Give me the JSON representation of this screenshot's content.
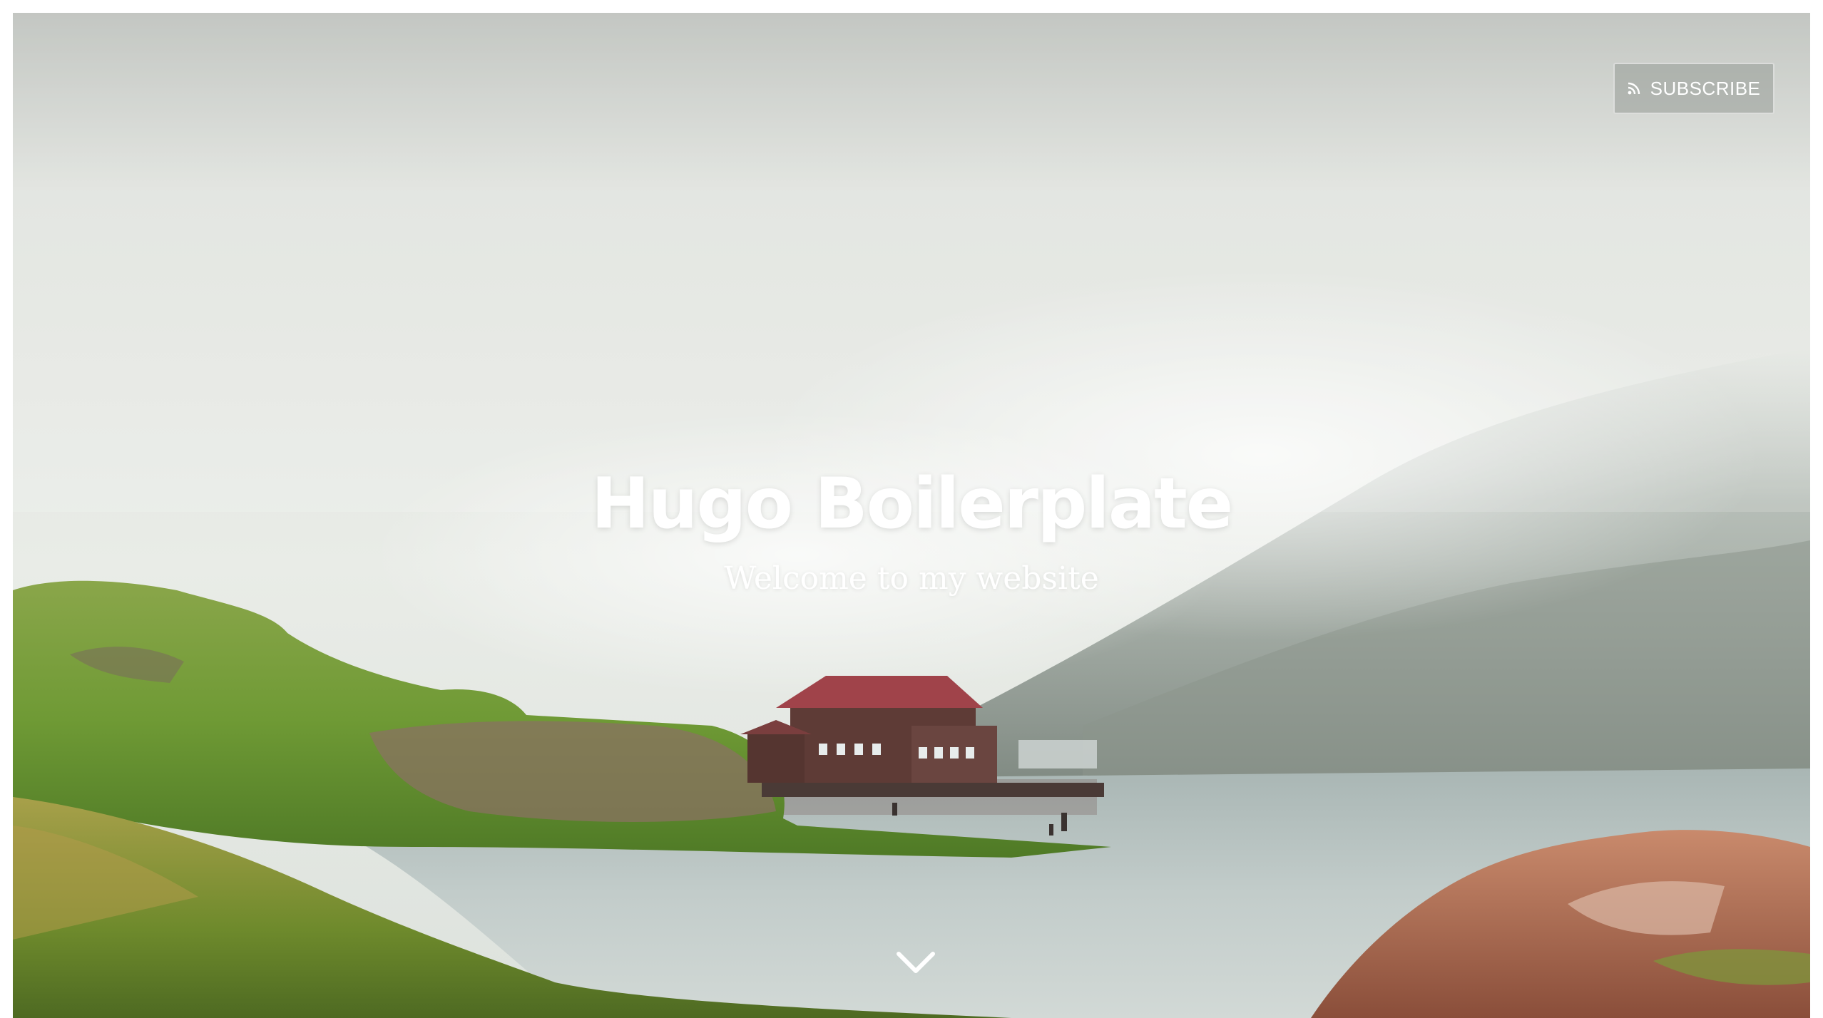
{
  "header": {
    "subscribe_label": "SUBSCRIBE",
    "subscribe_icon": "rss-icon"
  },
  "hero": {
    "title": "Hugo Boilerplate",
    "description": "Welcome to my website",
    "scroll_icon": "chevron-down-icon"
  },
  "colors": {
    "sky": "#e4e8e3",
    "grass": "#7fa33c",
    "lake": "#b9c6c4",
    "cabin_roof": "#a0434a",
    "rock": "#b06a50"
  }
}
